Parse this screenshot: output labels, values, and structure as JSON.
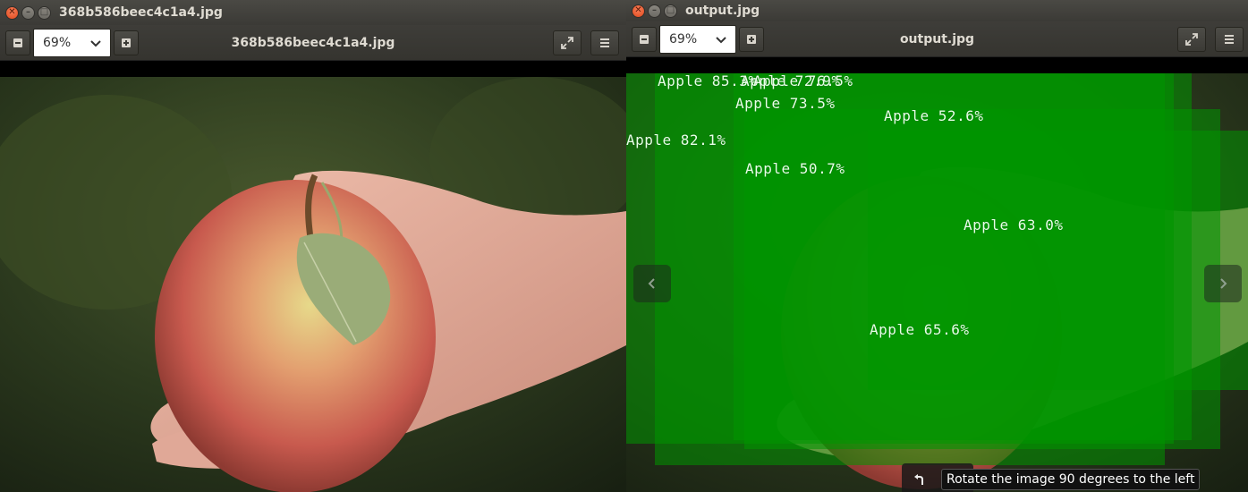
{
  "left_window": {
    "title": "368b586beec4c1a4.jpg",
    "zoom": "69%",
    "toolbar_title": "368b586beec4c1a4.jpg"
  },
  "right_window": {
    "title": "output.jpg",
    "zoom": "69%",
    "toolbar_title": "output.jpg",
    "tooltip": "Rotate the image 90 degrees to the left",
    "detections": [
      {
        "label": "Apple 85.3%"
      },
      {
        "label": "Apple 72.9%"
      },
      {
        "label": "Apple 76.5%"
      },
      {
        "label": "Apple 73.5%"
      },
      {
        "label": "Apple 52.6%"
      },
      {
        "label": "Apple 82.1%"
      },
      {
        "label": "Apple 50.7%"
      },
      {
        "label": "Apple 63.0%"
      },
      {
        "label": "Apple 65.6%"
      }
    ]
  },
  "icons": {
    "close": "close-icon",
    "minimize": "minimize-icon",
    "maximize": "maximize-icon",
    "zoom_out": "zoom-out-icon",
    "zoom_in": "zoom-in-icon",
    "dropdown": "chevron-down-icon",
    "fullscreen": "fullscreen-icon",
    "menu": "hamburger-menu-icon",
    "previous": "chevron-left-icon",
    "next": "chevron-right-icon",
    "rotate_left": "rotate-left-icon"
  },
  "colors": {
    "titlebar": "#3c3b37",
    "close_button": "#e95420",
    "detection_box": "#009600"
  }
}
